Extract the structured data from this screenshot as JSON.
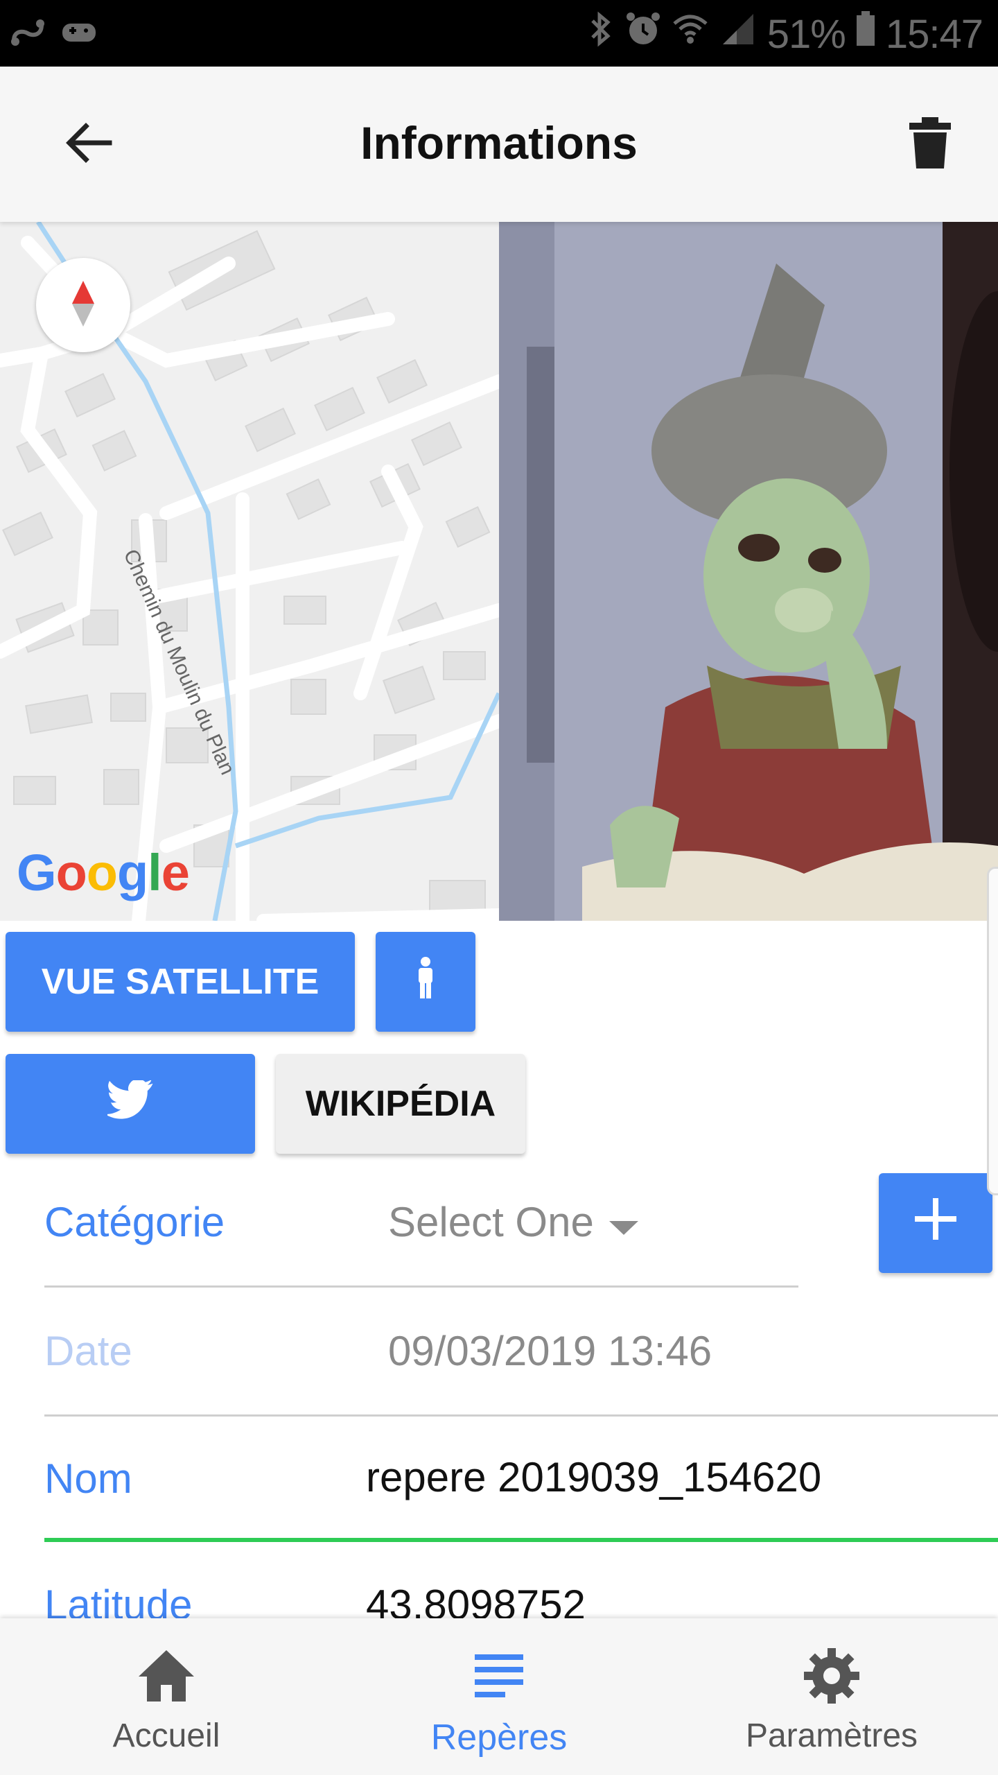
{
  "status_bar": {
    "battery": "51%",
    "time": "15:47",
    "left_icons": [
      "notification-icon",
      "gamepad-icon"
    ],
    "right_icons": [
      "bluetooth-icon",
      "alarm-icon",
      "wifi-icon",
      "signal-icon",
      "battery-icon"
    ]
  },
  "app_bar": {
    "title": "Informations",
    "back_icon": "arrow-back-icon",
    "delete_icon": "trash-icon"
  },
  "map": {
    "street_label": "Chemin du Moulin du Plan",
    "logo": "Google"
  },
  "buttons": {
    "satellite": "VUE SATELLITE",
    "person_icon": "person-icon",
    "twitter_icon": "twitter-icon",
    "wikipedia": "WIKIPÉDIA",
    "add_icon": "plus-icon"
  },
  "form": {
    "categorie_label": "Catégorie",
    "categorie_value": "Select One",
    "date_label": "Date",
    "date_value": "09/03/2019 13:46",
    "nom_label": "Nom",
    "nom_value": "repere 2019039_154620",
    "latitude_label": "Latitude",
    "latitude_value": "43.8098752"
  },
  "bottom_nav": {
    "items": [
      {
        "label": "Accueil",
        "icon": "home-icon",
        "active": false
      },
      {
        "label": "Repères",
        "icon": "list-icon",
        "active": true
      },
      {
        "label": "Paramètres",
        "icon": "gear-icon",
        "active": false
      }
    ]
  },
  "colors": {
    "accent": "#4285f4",
    "focus_underline": "#2ecc55",
    "app_bar": "#f6f6f6",
    "status_bar": "#000000"
  }
}
